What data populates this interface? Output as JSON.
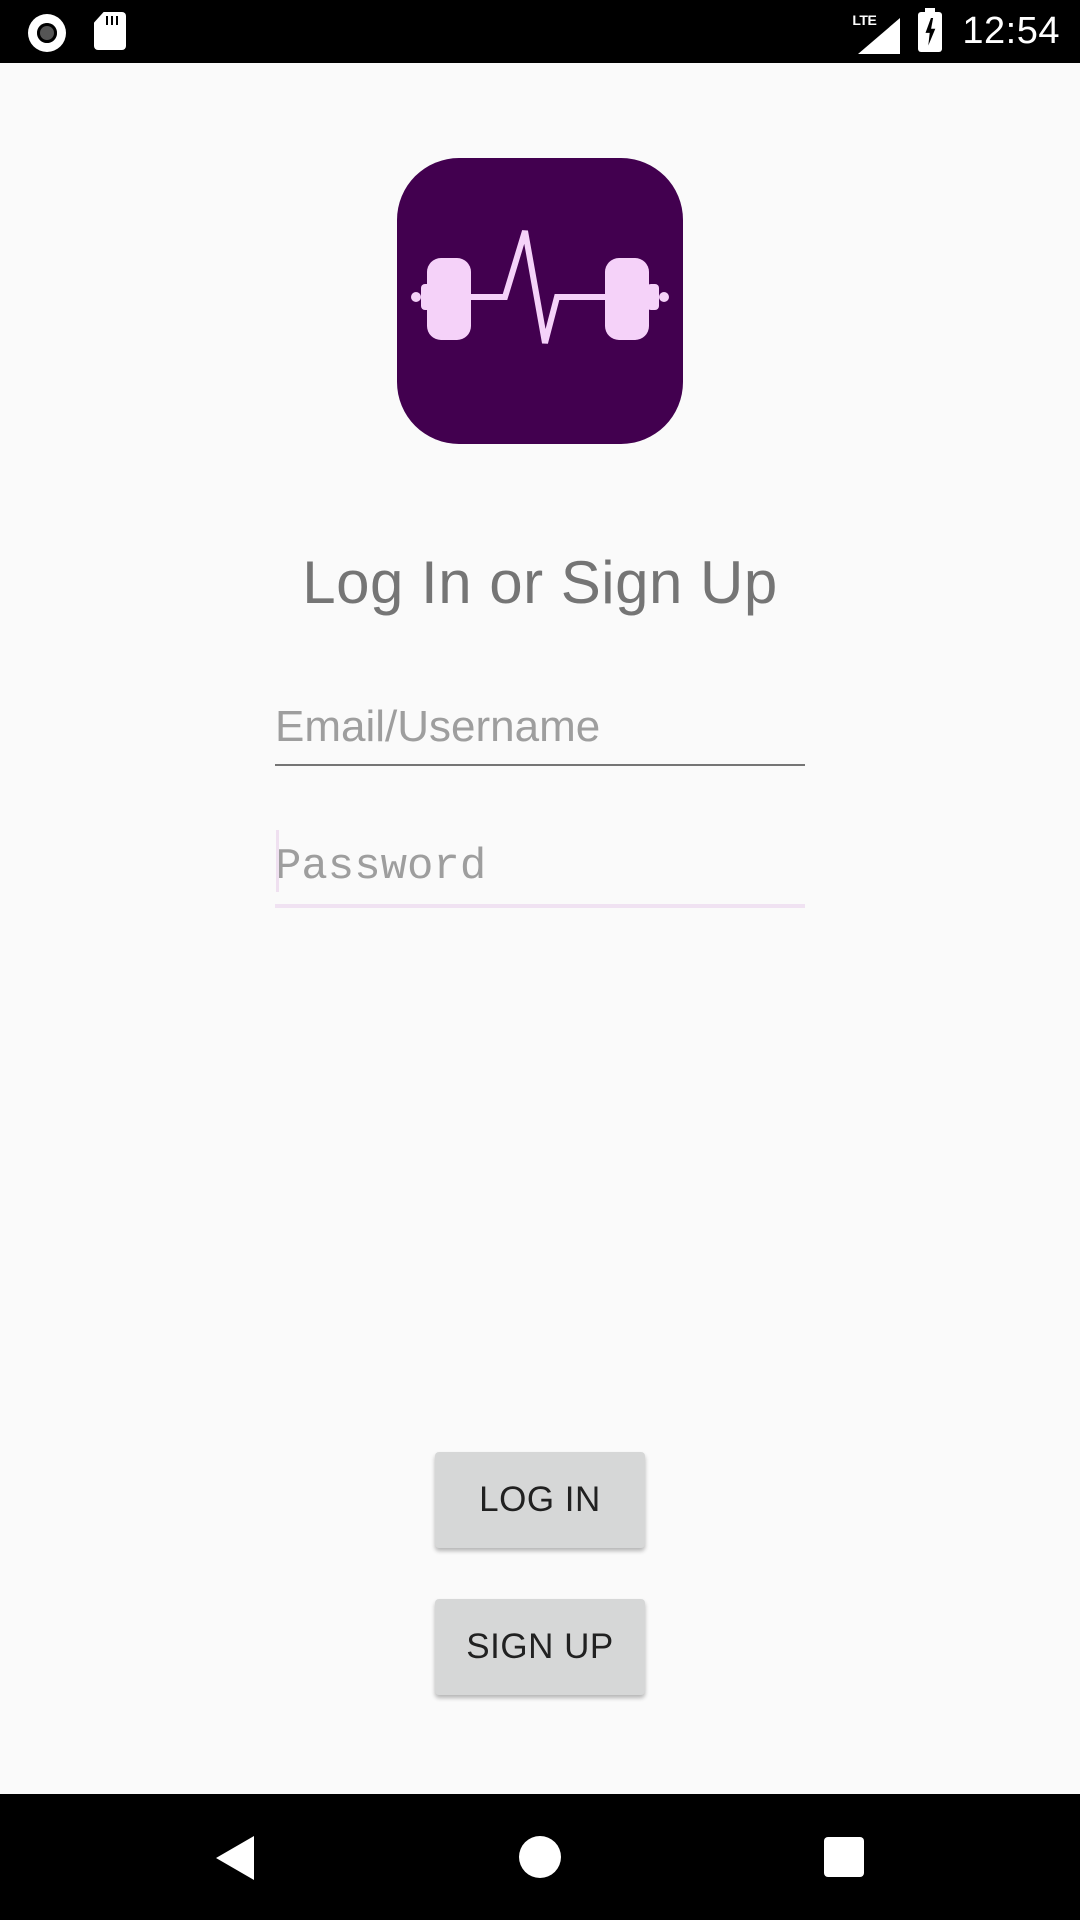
{
  "status_bar": {
    "time": "12:54",
    "network_type": "LTE",
    "icons": [
      "screen-record-icon",
      "sd-card-icon",
      "lte-signal-icon",
      "battery-charging-icon"
    ]
  },
  "logo": {
    "icon": "dumbbell-heartbeat-icon",
    "colors": {
      "background": "#42004f",
      "foreground": "#f5d2f9"
    }
  },
  "login": {
    "heading": "Log In or Sign Up",
    "email_placeholder": "Email/Username",
    "email_value": "",
    "password_placeholder": "Password",
    "password_value": "",
    "login_button": "LOG IN",
    "signup_button": "SIGN UP"
  },
  "nav_bar": {
    "icons": [
      "back-icon",
      "home-icon",
      "recents-icon"
    ]
  }
}
